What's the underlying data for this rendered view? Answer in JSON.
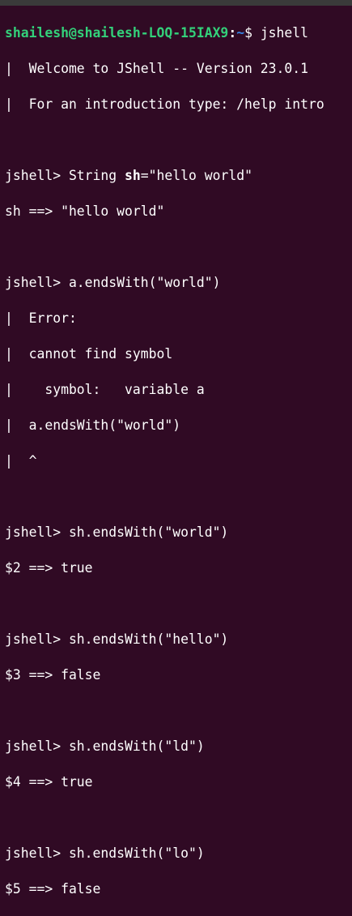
{
  "prompt": {
    "user_host": "shailesh@shailesh-LOQ-15IAX9",
    "separator": ":",
    "path": "~",
    "symbol": "$ ",
    "command": "jshell"
  },
  "colors": {
    "background": "#300a24",
    "user_host": "#33d17a",
    "path": "#3584e4",
    "text": "#ffffff"
  },
  "welcome": [
    "|  Welcome to JShell -- Version 23.0.1",
    "|  For an introduction type: /help intro"
  ],
  "session": {
    "decl_prompt": "jshell> String ",
    "decl_var": "sh",
    "decl_rest": "=\"hello world\"",
    "decl_result": "sh ==> \"hello world\"",
    "cmd_a": "jshell> a.endsWith(\"world\")",
    "error_lines": [
      "|  Error:",
      "|  cannot find symbol",
      "|    symbol:   variable a",
      "|  a.endsWith(\"world\")",
      "|  ^"
    ],
    "cmd_2": "jshell> sh.endsWith(\"world\")",
    "res_2": "$2 ==> true",
    "cmd_3": "jshell> sh.endsWith(\"hello\")",
    "res_3": "$3 ==> false",
    "cmd_4": "jshell> sh.endsWith(\"ld\")",
    "res_4": "$4 ==> true",
    "cmd_5": "jshell> sh.endsWith(\"lo\")",
    "res_5": "$5 ==> false"
  }
}
